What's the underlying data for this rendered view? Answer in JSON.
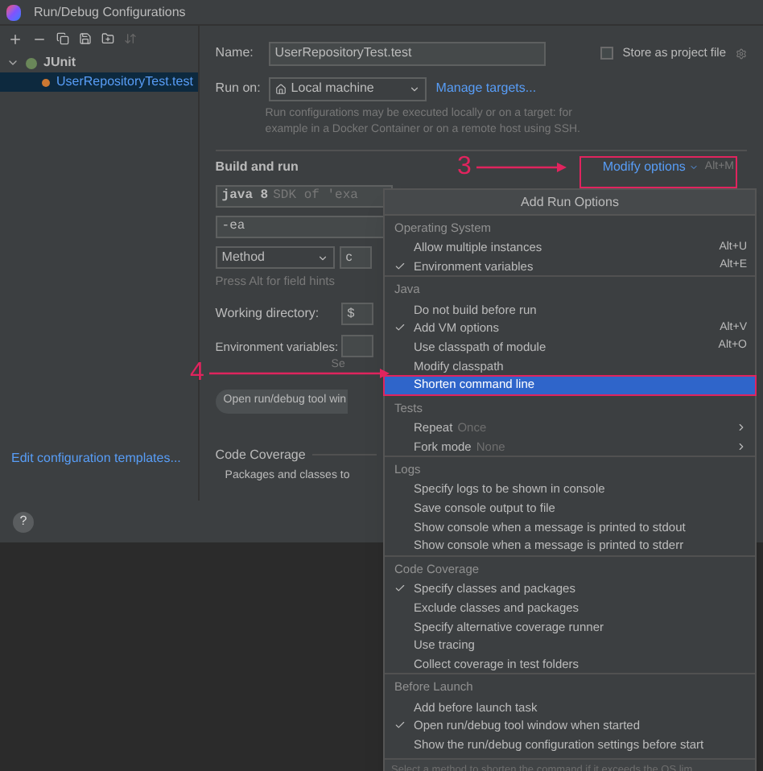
{
  "window": {
    "title": "Run/Debug Configurations"
  },
  "sidebar": {
    "tree": [
      {
        "label": "JUnit",
        "expanded": true,
        "selected": false,
        "children": [
          {
            "label": "UserRepositoryTest.test",
            "selected": true
          }
        ]
      }
    ],
    "templates_link": "Edit configuration templates...",
    "help": "?"
  },
  "form": {
    "name_label": "Name:",
    "name_value": "UserRepositoryTest.test",
    "store_label": "Store as project file",
    "store_checked": false,
    "run_on_label": "Run on:",
    "run_on_value": "Local machine",
    "manage_link": "Manage targets...",
    "run_on_hint": "Run configurations may be executed locally or on a target: for example in a Docker Container or on a remote host using SSH.",
    "build_title": "Build and run",
    "modify_label": "Modify options",
    "modify_shortcut": "Alt+M",
    "jre_value": "java 8",
    "jre_hint": "SDK of 'exa",
    "vm_value": "-ea",
    "kind_value": "Method",
    "kind_field_value": "c",
    "field_hints": "Press Alt for field hints",
    "workdir_label": "Working directory:",
    "workdir_value": "$",
    "env_label": "Environment variables:",
    "env_hint": "Se",
    "tool_window_tag": "Open run/debug tool win",
    "coverage_title": "Code Coverage",
    "coverage_hint": "Packages and classes to"
  },
  "callouts": [
    {
      "label": "3"
    },
    {
      "label": "4"
    }
  ],
  "popup": {
    "title": "Add Run Options",
    "sections": [
      {
        "title": "Operating System",
        "items": [
          {
            "label": "Allow multiple instances",
            "checked": false,
            "selected": false,
            "shortcut": "Alt+U"
          },
          {
            "label": "Environment variables",
            "checked": true,
            "selected": false,
            "shortcut": "Alt+E"
          }
        ]
      },
      {
        "title": "Java",
        "items": [
          {
            "label": "Do not build before run",
            "checked": false,
            "selected": false
          },
          {
            "label": "Add VM options",
            "checked": true,
            "selected": false,
            "shortcut": "Alt+V"
          },
          {
            "label": "Use classpath of module",
            "checked": false,
            "selected": false,
            "shortcut": "Alt+O"
          },
          {
            "label": "Modify classpath",
            "checked": false,
            "selected": false
          },
          {
            "label": "Shorten command line",
            "checked": false,
            "selected": true
          }
        ]
      },
      {
        "title": "Tests",
        "items": [
          {
            "label": "Repeat",
            "value": "Once",
            "checked": false,
            "selected": false,
            "submenu": true
          },
          {
            "label": "Fork mode",
            "value": "None",
            "checked": false,
            "selected": false,
            "submenu": true
          }
        ]
      },
      {
        "title": "Logs",
        "items": [
          {
            "label": "Specify logs to be shown in console",
            "checked": false,
            "selected": false
          },
          {
            "label": "Save console output to file",
            "checked": false,
            "selected": false
          },
          {
            "label": "Show console when a message is printed to stdout",
            "checked": false,
            "selected": false
          },
          {
            "label": "Show console when a message is printed to stderr",
            "checked": false,
            "selected": false
          }
        ]
      },
      {
        "title": "Code Coverage",
        "items": [
          {
            "label": "Specify classes and packages",
            "checked": true,
            "selected": false
          },
          {
            "label": "Exclude classes and packages",
            "checked": false,
            "selected": false
          },
          {
            "label": "Specify alternative coverage runner",
            "checked": false,
            "selected": false
          },
          {
            "label": "Use tracing",
            "checked": false,
            "selected": false
          },
          {
            "label": "Collect coverage in test folders",
            "checked": false,
            "selected": false
          }
        ]
      },
      {
        "title": "Before Launch",
        "items": [
          {
            "label": "Add before launch task",
            "checked": false,
            "selected": false
          },
          {
            "label": "Open run/debug tool window when started",
            "checked": true,
            "selected": false
          },
          {
            "label": "Show the run/debug configuration settings before start",
            "checked": false,
            "selected": false
          }
        ]
      }
    ],
    "hint": "Select a method to shorten the command if it exceeds the OS lim"
  }
}
